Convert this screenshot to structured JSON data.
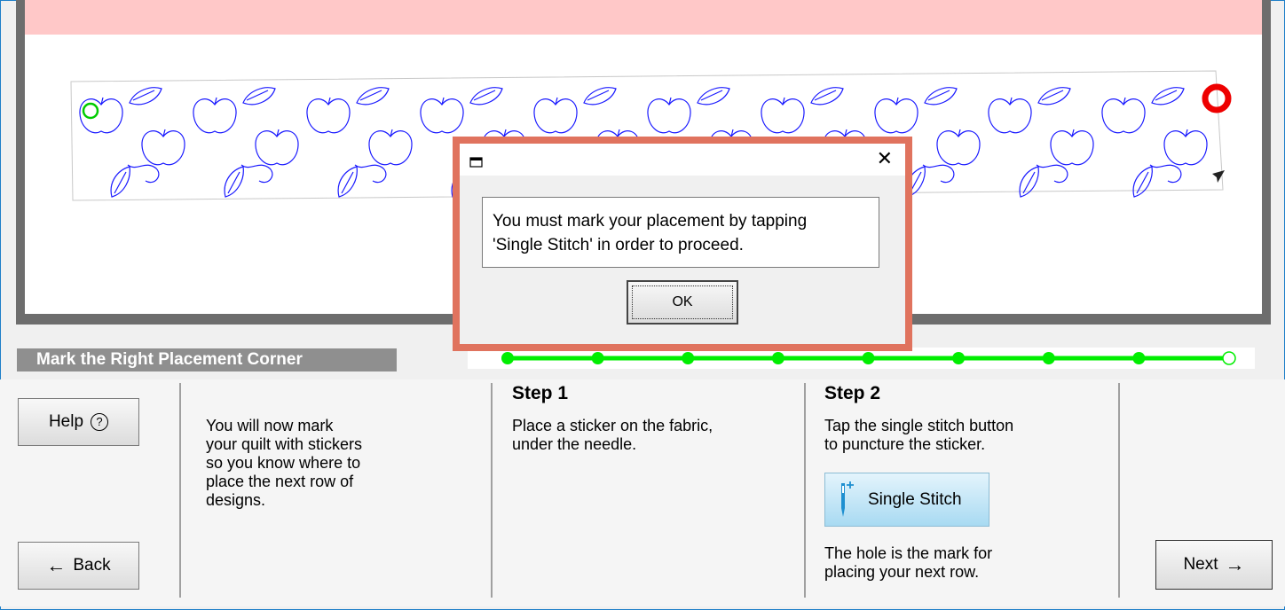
{
  "canvas": {
    "stitch_color": "#1a1aff",
    "start_marker_color": "#00cc00",
    "end_marker_color": "#ee0000"
  },
  "status": {
    "title": "Mark the Right Placement Corner",
    "progress_color": "#00ee00",
    "progress_nodes": 9,
    "progress_completed": 8
  },
  "help": {
    "label": "Help",
    "icon": "question-circle-icon",
    "icon_glyph": "ⓘ"
  },
  "back": {
    "label": "Back",
    "icon": "arrow-left-icon",
    "icon_glyph": "←"
  },
  "next": {
    "label": "Next",
    "icon": "arrow-right-icon",
    "icon_glyph": "→"
  },
  "intro": {
    "text": "You will now mark\nyour quilt with stickers\nso you know where to\nplace the next row of\ndesigns."
  },
  "step1": {
    "title": "Step 1",
    "text": "Place a sticker on the fabric,\nunder the needle."
  },
  "step2": {
    "title": "Step 2",
    "text": "Tap the single stitch button\nto puncture the sticker.",
    "button_label": "Single Stitch",
    "button_icon": "needle-icon",
    "after_text": "The hole is the mark for\nplacing your next row."
  },
  "dialog": {
    "close_glyph": "✕",
    "message": "You must mark your placement by tapping\n'Single Stitch' in order to proceed.",
    "ok_label": "OK"
  }
}
